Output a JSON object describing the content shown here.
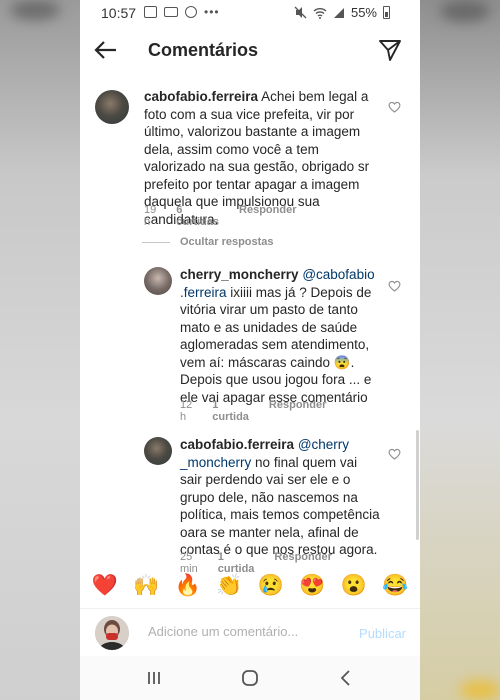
{
  "status_bar": {
    "time": "10:57",
    "notif_dots": "•••",
    "battery": "55%"
  },
  "header": {
    "title": "Comentários"
  },
  "comments": [
    {
      "username": "cabofabio.ferreira",
      "text": "Achei bem legal a foto com a sua vice prefeita, vir por último, valorizou bastante a imagem dela, assim como você a tem valorizado na sua gestão, obrigado sr prefeito por tentar apagar a imagem daquela que impulsionou sua candidatura.",
      "time": "19 h",
      "likes": "6 curtidas",
      "reply_label": "Responder"
    }
  ],
  "hide_replies_label": "Ocultar respostas",
  "replies": [
    {
      "username": "cherry_moncherry",
      "mention": "@cabofabio .ferreira",
      "text": "ixiiii mas já ? Depois de vitória virar um pasto de tanto mato e as unidades de saúde aglomeradas sem atendimento, vem  aí: máscaras caindo 😨. Depois que usou jogou fora ... e ele vai apagar esse comentário",
      "time": "12 h",
      "likes": "1 curtida",
      "reply_label": "Responder"
    },
    {
      "username": "cabofabio.ferreira",
      "mention": "@cherry _moncherry",
      "text": "no final quem vai sair perdendo vai ser ele e o grupo dele, não nascemos na política, mais temos competência oara se manter nela, afinal de contas é o que nos restou agora.",
      "time": "25 min",
      "likes": "1 curtida",
      "reply_label": "Responder"
    }
  ],
  "emoji_bar": [
    "❤️",
    "🙌",
    "🔥",
    "👏",
    "😢",
    "😍",
    "😮",
    "😂"
  ],
  "comment_input": {
    "placeholder": "Adicione um comentário...",
    "publish_label": "Publicar"
  },
  "icons": {
    "back": "back-arrow-icon",
    "share": "send-icon",
    "heart": "heart-outline-icon",
    "nav": [
      "recent-apps-icon",
      "home-icon",
      "back-icon"
    ]
  },
  "colors": {
    "mention": "#00376b",
    "meta": "#8e8e8e",
    "publish": "#b3dbff"
  }
}
